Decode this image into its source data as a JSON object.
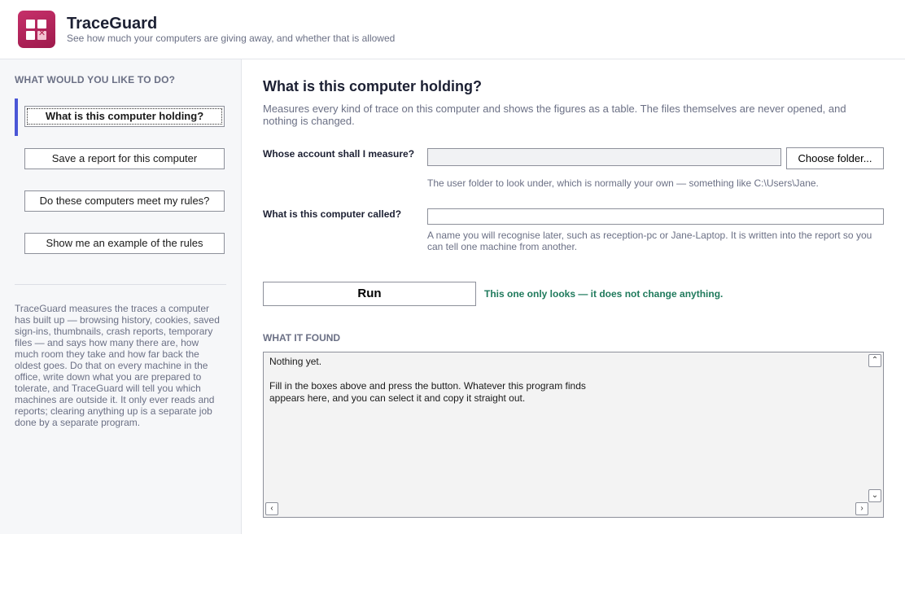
{
  "app": {
    "title": "TraceGuard",
    "subtitle": "See how much your computers are giving away, and whether that is allowed",
    "logo_icon": "grid-with-x-icon",
    "brand_color": "#b0224f",
    "accent_color": "#4a56d6"
  },
  "sidebar": {
    "heading": "WHAT WOULD YOU LIKE TO DO?",
    "items": [
      {
        "label": "What is this computer holding?",
        "active": true
      },
      {
        "label": "Save a report for this computer",
        "active": false
      },
      {
        "label": "Do these computers meet my rules?",
        "active": false
      },
      {
        "label": "Show me an example of the rules",
        "active": false
      }
    ],
    "about": "TraceGuard measures the traces a computer has built up — browsing history, cookies, saved sign-ins, thumbnails, crash reports, temporary files — and says how many there are, how much room they take and how far back the oldest goes. Do that on every machine in the office, write down what you are prepared to tolerate, and TraceGuard will tell you which machines are outside it. It only ever reads and reports; clearing anything up is a separate job done by a separate program."
  },
  "main": {
    "title": "What is this computer holding?",
    "description": "Measures every kind of trace on this computer and shows the figures as a table. The files themselves are never opened, and nothing is changed.",
    "account": {
      "label": "Whose account shall I measure?",
      "value": "",
      "choose_label": "Choose folder...",
      "hint": "The user folder to look under, which is normally your own — something like C:\\Users\\Jane."
    },
    "computer": {
      "label": "What is this computer called?",
      "value": "",
      "hint": "A name you will recognise later, such as reception-pc or Jane-Laptop. It is written into the report so you can tell one machine from another."
    },
    "run_label": "Run",
    "run_note": "This one only looks — it does not change anything.",
    "run_note_color": "#1f7a5c",
    "found_heading": "WHAT IT FOUND",
    "output": "Nothing yet.\n\nFill in the boxes above and press the button. Whatever this program finds\nappears here, and you can select it and copy it straight out."
  }
}
